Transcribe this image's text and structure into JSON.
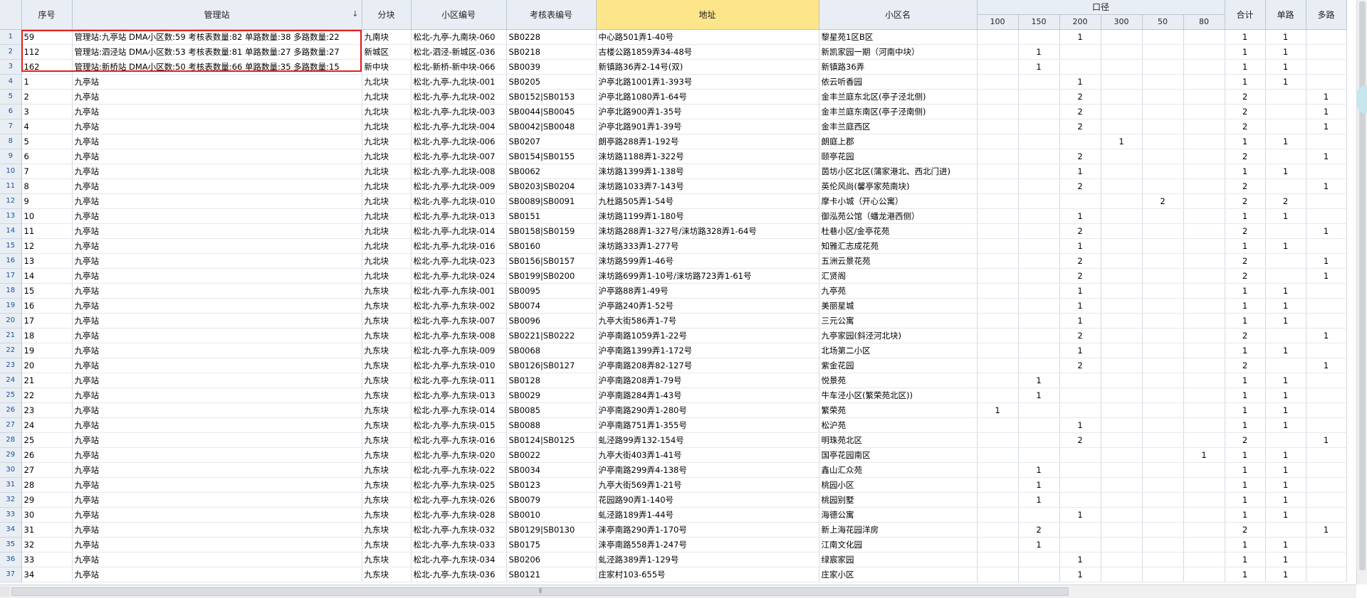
{
  "header": {
    "row_number_corner": "",
    "seq": "序号",
    "station": "管理站",
    "block": "分块",
    "district_code": "小区编号",
    "meter_code": "考核表编号",
    "address": "地址",
    "district_name": "小区名",
    "diameter_group": "口径",
    "diameters": [
      "100",
      "150",
      "200",
      "300",
      "50",
      "80"
    ],
    "total": "合计",
    "single": "单路",
    "multi": "多路",
    "sort_icon": "sort-desc-icon"
  },
  "rows": [
    {
      "rn": "1",
      "seq": "59",
      "station": "管理站:九亭站  DMA小区数:59 考核表数量:82 单路数量:38 多路数量:22",
      "block": "九南块",
      "code": "松北-九亭-九南块-060",
      "meter": "SB0228",
      "addr": "中心路501弄1-40号",
      "name": "黎星苑1区B区",
      "d100": "",
      "d150": "",
      "d200": "1",
      "d300": "",
      "d50": "",
      "d80": "",
      "total": "1",
      "single": "1",
      "multi": ""
    },
    {
      "rn": "2",
      "seq": "112",
      "station": "管理站:泗泾站  DMA小区数:53 考核表数量:81 单路数量:27 多路数量:27",
      "block": "新城区",
      "code": "松北-泗泾-新城区-036",
      "meter": "SB0218",
      "addr": "古楼公路1859弄34-48号",
      "name": "新凯家园一期（河南中块）",
      "d100": "",
      "d150": "1",
      "d200": "",
      "d300": "",
      "d50": "",
      "d80": "",
      "total": "1",
      "single": "1",
      "multi": ""
    },
    {
      "rn": "3",
      "seq": "162",
      "station": "管理站:新桥站  DMA小区数:50 考核表数量:66 单路数量:35 多路数量:15",
      "block": "新中块",
      "code": "松北-新桥-新中块-066",
      "meter": "SB0039",
      "addr": "新镇路36弄2-14号(双)",
      "name": "新镇路36弄",
      "d100": "",
      "d150": "1",
      "d200": "",
      "d300": "",
      "d50": "",
      "d80": "",
      "total": "1",
      "single": "1",
      "multi": ""
    },
    {
      "rn": "4",
      "seq": "1",
      "station": "九亭站",
      "block": "九北块",
      "code": "松北-九亭-九北块-001",
      "meter": "SB0205",
      "addr": "沪亭北路1001弄1-393号",
      "name": "依云听香园",
      "d100": "",
      "d150": "",
      "d200": "1",
      "d300": "",
      "d50": "",
      "d80": "",
      "total": "1",
      "single": "1",
      "multi": ""
    },
    {
      "rn": "5",
      "seq": "2",
      "station": "九亭站",
      "block": "九北块",
      "code": "松北-九亭-九北块-002",
      "meter": "SB0152|SB0153",
      "addr": "沪亭北路1080弄1-64号",
      "name": "金丰兰庭东北区(亭子泾北侧)",
      "d100": "",
      "d150": "",
      "d200": "2",
      "d300": "",
      "d50": "",
      "d80": "",
      "total": "2",
      "single": "",
      "multi": "1"
    },
    {
      "rn": "6",
      "seq": "3",
      "station": "九亭站",
      "block": "九北块",
      "code": "松北-九亭-九北块-003",
      "meter": "SB0044|SB0045",
      "addr": "沪亭北路900弄1-35号",
      "name": "金丰兰庭东南区(亭子泾南侧)",
      "d100": "",
      "d150": "",
      "d200": "2",
      "d300": "",
      "d50": "",
      "d80": "",
      "total": "2",
      "single": "",
      "multi": "1"
    },
    {
      "rn": "7",
      "seq": "4",
      "station": "九亭站",
      "block": "九北块",
      "code": "松北-九亭-九北块-004",
      "meter": "SB0042|SB0048",
      "addr": "沪亭北路901弄1-39号",
      "name": "金丰兰庭西区",
      "d100": "",
      "d150": "",
      "d200": "2",
      "d300": "",
      "d50": "",
      "d80": "",
      "total": "2",
      "single": "",
      "multi": "1"
    },
    {
      "rn": "8",
      "seq": "5",
      "station": "九亭站",
      "block": "九北块",
      "code": "松北-九亭-九北块-006",
      "meter": "SB0207",
      "addr": "朗亭路288弄1-192号",
      "name": "朗庭上郡",
      "d100": "",
      "d150": "",
      "d200": "",
      "d300": "1",
      "d50": "",
      "d80": "",
      "total": "1",
      "single": "1",
      "multi": ""
    },
    {
      "rn": "9",
      "seq": "6",
      "station": "九亭站",
      "block": "九北块",
      "code": "松北-九亭-九北块-007",
      "meter": "SB0154|SB0155",
      "addr": "涞坊路1188弄1-322号",
      "name": "颐亭花园",
      "d100": "",
      "d150": "",
      "d200": "2",
      "d300": "",
      "d50": "",
      "d80": "",
      "total": "2",
      "single": "",
      "multi": "1"
    },
    {
      "rn": "10",
      "seq": "7",
      "station": "九亭站",
      "block": "九北块",
      "code": "松北-九亭-九北块-008",
      "meter": "SB0062",
      "addr": "涞坊路1399弄1-138号",
      "name": "茵坊小区北区(蒲家港北、西北门进)",
      "d100": "",
      "d150": "",
      "d200": "1",
      "d300": "",
      "d50": "",
      "d80": "",
      "total": "1",
      "single": "1",
      "multi": ""
    },
    {
      "rn": "11",
      "seq": "8",
      "station": "九亭站",
      "block": "九北块",
      "code": "松北-九亭-九北块-009",
      "meter": "SB0203|SB0204",
      "addr": "涞坊路1033弄7-143号",
      "name": "英伦风尚(馨亭家苑南块)",
      "d100": "",
      "d150": "",
      "d200": "2",
      "d300": "",
      "d50": "",
      "d80": "",
      "total": "2",
      "single": "",
      "multi": "1"
    },
    {
      "rn": "12",
      "seq": "9",
      "station": "九亭站",
      "block": "九北块",
      "code": "松北-九亭-九北块-010",
      "meter": "SB0089|SB0091",
      "addr": "九杜路505弄1-54号",
      "name": "摩卡小城（开心公寓）",
      "d100": "",
      "d150": "",
      "d200": "",
      "d300": "",
      "d50": "2",
      "d80": "",
      "total": "2",
      "single": "2",
      "multi": ""
    },
    {
      "rn": "13",
      "seq": "10",
      "station": "九亭站",
      "block": "九北块",
      "code": "松北-九亭-九北块-013",
      "meter": "SB0151",
      "addr": "涞坊路1199弄1-180号",
      "name": "御泓苑公馆（蟠龙港西侧）",
      "d100": "",
      "d150": "",
      "d200": "1",
      "d300": "",
      "d50": "",
      "d80": "",
      "total": "1",
      "single": "1",
      "multi": ""
    },
    {
      "rn": "14",
      "seq": "11",
      "station": "九亭站",
      "block": "九北块",
      "code": "松北-九亭-九北块-014",
      "meter": "SB0158|SB0159",
      "addr": "涞坊路288弄1-327号/涞坊路328弄1-64号",
      "name": "杜巷小区/金亭花苑",
      "d100": "",
      "d150": "",
      "d200": "2",
      "d300": "",
      "d50": "",
      "d80": "",
      "total": "2",
      "single": "",
      "multi": "1"
    },
    {
      "rn": "15",
      "seq": "12",
      "station": "九亭站",
      "block": "九北块",
      "code": "松北-九亭-九北块-016",
      "meter": "SB0160",
      "addr": "涞坊路333弄1-277号",
      "name": "知雅汇志成花苑",
      "d100": "",
      "d150": "",
      "d200": "1",
      "d300": "",
      "d50": "",
      "d80": "",
      "total": "1",
      "single": "1",
      "multi": ""
    },
    {
      "rn": "16",
      "seq": "13",
      "station": "九亭站",
      "block": "九北块",
      "code": "松北-九亭-九北块-023",
      "meter": "SB0156|SB0157",
      "addr": "涞坊路599弄1-46号",
      "name": "五洲云景花苑",
      "d100": "",
      "d150": "",
      "d200": "2",
      "d300": "",
      "d50": "",
      "d80": "",
      "total": "2",
      "single": "",
      "multi": "1"
    },
    {
      "rn": "17",
      "seq": "14",
      "station": "九亭站",
      "block": "九北块",
      "code": "松北-九亭-九北块-024",
      "meter": "SB0199|SB0200",
      "addr": "涞坊路699弄1-10号/涞坊路723弄1-61号",
      "name": "汇贤阁",
      "d100": "",
      "d150": "",
      "d200": "2",
      "d300": "",
      "d50": "",
      "d80": "",
      "total": "2",
      "single": "",
      "multi": "1"
    },
    {
      "rn": "18",
      "seq": "15",
      "station": "九亭站",
      "block": "九东块",
      "code": "松北-九亭-九东块-001",
      "meter": "SB0095",
      "addr": "沪亭路88弄1-49号",
      "name": "九亭苑",
      "d100": "",
      "d150": "",
      "d200": "1",
      "d300": "",
      "d50": "",
      "d80": "",
      "total": "1",
      "single": "1",
      "multi": ""
    },
    {
      "rn": "19",
      "seq": "16",
      "station": "九亭站",
      "block": "九东块",
      "code": "松北-九亭-九东块-002",
      "meter": "SB0074",
      "addr": "沪亭路240弄1-52号",
      "name": "美丽星城",
      "d100": "",
      "d150": "",
      "d200": "1",
      "d300": "",
      "d50": "",
      "d80": "",
      "total": "1",
      "single": "1",
      "multi": ""
    },
    {
      "rn": "20",
      "seq": "17",
      "station": "九亭站",
      "block": "九东块",
      "code": "松北-九亭-九东块-007",
      "meter": "SB0096",
      "addr": "九亭大街586弄1-7号",
      "name": "三元公寓",
      "d100": "",
      "d150": "",
      "d200": "1",
      "d300": "",
      "d50": "",
      "d80": "",
      "total": "1",
      "single": "1",
      "multi": ""
    },
    {
      "rn": "21",
      "seq": "18",
      "station": "九亭站",
      "block": "九东块",
      "code": "松北-九亭-九东块-008",
      "meter": "SB0221|SB0222",
      "addr": "沪亭南路1059弄1-22号",
      "name": "九亭家园(斜泾河北块)",
      "d100": "",
      "d150": "",
      "d200": "2",
      "d300": "",
      "d50": "",
      "d80": "",
      "total": "2",
      "single": "",
      "multi": "1"
    },
    {
      "rn": "22",
      "seq": "19",
      "station": "九亭站",
      "block": "九东块",
      "code": "松北-九亭-九东块-009",
      "meter": "SB0068",
      "addr": "沪亭南路1399弄1-172号",
      "name": "北场第二小区",
      "d100": "",
      "d150": "",
      "d200": "1",
      "d300": "",
      "d50": "",
      "d80": "",
      "total": "1",
      "single": "1",
      "multi": ""
    },
    {
      "rn": "23",
      "seq": "20",
      "station": "九亭站",
      "block": "九东块",
      "code": "松北-九亭-九东块-010",
      "meter": "SB0126|SB0127",
      "addr": "沪亭南路208弄82-127号",
      "name": "紫金花园",
      "d100": "",
      "d150": "",
      "d200": "2",
      "d300": "",
      "d50": "",
      "d80": "",
      "total": "2",
      "single": "",
      "multi": "1"
    },
    {
      "rn": "24",
      "seq": "21",
      "station": "九亭站",
      "block": "九东块",
      "code": "松北-九亭-九东块-011",
      "meter": "SB0128",
      "addr": "沪亭南路208弄1-79号",
      "name": "悦景苑",
      "d100": "",
      "d150": "1",
      "d200": "",
      "d300": "",
      "d50": "",
      "d80": "",
      "total": "1",
      "single": "1",
      "multi": ""
    },
    {
      "rn": "25",
      "seq": "22",
      "station": "九亭站",
      "block": "九东块",
      "code": "松北-九亭-九东块-013",
      "meter": "SB0029",
      "addr": "沪亭南路284弄1-43号",
      "name": "牛车泾小区(繁荣苑北区))",
      "d100": "",
      "d150": "1",
      "d200": "",
      "d300": "",
      "d50": "",
      "d80": "",
      "total": "1",
      "single": "1",
      "multi": ""
    },
    {
      "rn": "26",
      "seq": "23",
      "station": "九亭站",
      "block": "九东块",
      "code": "松北-九亭-九东块-014",
      "meter": "SB0085",
      "addr": "沪亭南路290弄1-280号",
      "name": "繁荣苑",
      "d100": "1",
      "d150": "",
      "d200": "",
      "d300": "",
      "d50": "",
      "d80": "",
      "total": "1",
      "single": "1",
      "multi": ""
    },
    {
      "rn": "27",
      "seq": "24",
      "station": "九亭站",
      "block": "九东块",
      "code": "松北-九亭-九东块-015",
      "meter": "SB0088",
      "addr": "沪亭南路751弄1-355号",
      "name": "松沪苑",
      "d100": "",
      "d150": "",
      "d200": "1",
      "d300": "",
      "d50": "",
      "d80": "",
      "total": "1",
      "single": "1",
      "multi": ""
    },
    {
      "rn": "28",
      "seq": "25",
      "station": "九亭站",
      "block": "九东块",
      "code": "松北-九亭-九东块-016",
      "meter": "SB0124|SB0125",
      "addr": "虬泾路99弄132-154号",
      "name": "明珠苑北区",
      "d100": "",
      "d150": "",
      "d200": "2",
      "d300": "",
      "d50": "",
      "d80": "",
      "total": "2",
      "single": "",
      "multi": "1"
    },
    {
      "rn": "29",
      "seq": "26",
      "station": "九亭站",
      "block": "九东块",
      "code": "松北-九亭-九东块-020",
      "meter": "SB0022",
      "addr": "九亭大街403弄1-41号",
      "name": "国亭花园南区",
      "d100": "",
      "d150": "",
      "d200": "",
      "d300": "",
      "d50": "",
      "d80": "1",
      "total": "1",
      "single": "1",
      "multi": ""
    },
    {
      "rn": "30",
      "seq": "27",
      "station": "九亭站",
      "block": "九东块",
      "code": "松北-九亭-九东块-022",
      "meter": "SB0034",
      "addr": "沪亭南路299弄4-138号",
      "name": "鑫山汇众苑",
      "d100": "",
      "d150": "1",
      "d200": "",
      "d300": "",
      "d50": "",
      "d80": "",
      "total": "1",
      "single": "1",
      "multi": ""
    },
    {
      "rn": "31",
      "seq": "28",
      "station": "九亭站",
      "block": "九东块",
      "code": "松北-九亭-九东块-025",
      "meter": "SB0123",
      "addr": "九亭大街569弄1-21号",
      "name": "桃园小区",
      "d100": "",
      "d150": "1",
      "d200": "",
      "d300": "",
      "d50": "",
      "d80": "",
      "total": "1",
      "single": "1",
      "multi": ""
    },
    {
      "rn": "32",
      "seq": "29",
      "station": "九亭站",
      "block": "九东块",
      "code": "松北-九亭-九东块-026",
      "meter": "SB0079",
      "addr": "花园路90弄1-140号",
      "name": "桃园别墅",
      "d100": "",
      "d150": "1",
      "d200": "",
      "d300": "",
      "d50": "",
      "d80": "",
      "total": "1",
      "single": "1",
      "multi": ""
    },
    {
      "rn": "33",
      "seq": "30",
      "station": "九亭站",
      "block": "九东块",
      "code": "松北-九亭-九东块-028",
      "meter": "SB0010",
      "addr": "虬泾路189弄1-44号",
      "name": "海德公寓",
      "d100": "",
      "d150": "",
      "d200": "1",
      "d300": "",
      "d50": "",
      "d80": "",
      "total": "1",
      "single": "1",
      "multi": ""
    },
    {
      "rn": "34",
      "seq": "31",
      "station": "九亭站",
      "block": "九东块",
      "code": "松北-九亭-九东块-032",
      "meter": "SB0129|SB0130",
      "addr": "涞亭南路290弄1-170号",
      "name": "新上海花园洋房",
      "d100": "",
      "d150": "2",
      "d200": "",
      "d300": "",
      "d50": "",
      "d80": "",
      "total": "2",
      "single": "",
      "multi": "1"
    },
    {
      "rn": "35",
      "seq": "32",
      "station": "九亭站",
      "block": "九东块",
      "code": "松北-九亭-九东块-033",
      "meter": "SB0175",
      "addr": "涞亭南路558弄1-247号",
      "name": "江南文化园",
      "d100": "",
      "d150": "1",
      "d200": "",
      "d300": "",
      "d50": "",
      "d80": "",
      "total": "1",
      "single": "1",
      "multi": ""
    },
    {
      "rn": "36",
      "seq": "33",
      "station": "九亭站",
      "block": "九东块",
      "code": "松北-九亭-九东块-034",
      "meter": "SB0206",
      "addr": "虬泾路389弄1-129号",
      "name": "绿宸家园",
      "d100": "",
      "d150": "",
      "d200": "1",
      "d300": "",
      "d50": "",
      "d80": "",
      "total": "1",
      "single": "1",
      "multi": ""
    },
    {
      "rn": "37",
      "seq": "34",
      "station": "九亭站",
      "block": "九东块",
      "code": "松北-九亭-九东块-036",
      "meter": "SB0121",
      "addr": "庄家村103-655号",
      "name": "庄家小区",
      "d100": "",
      "d150": "",
      "d200": "1",
      "d300": "",
      "d50": "",
      "d80": "",
      "total": "1",
      "single": "1",
      "multi": ""
    }
  ],
  "scrollbars": {
    "horizontal_grip": "⦀"
  }
}
